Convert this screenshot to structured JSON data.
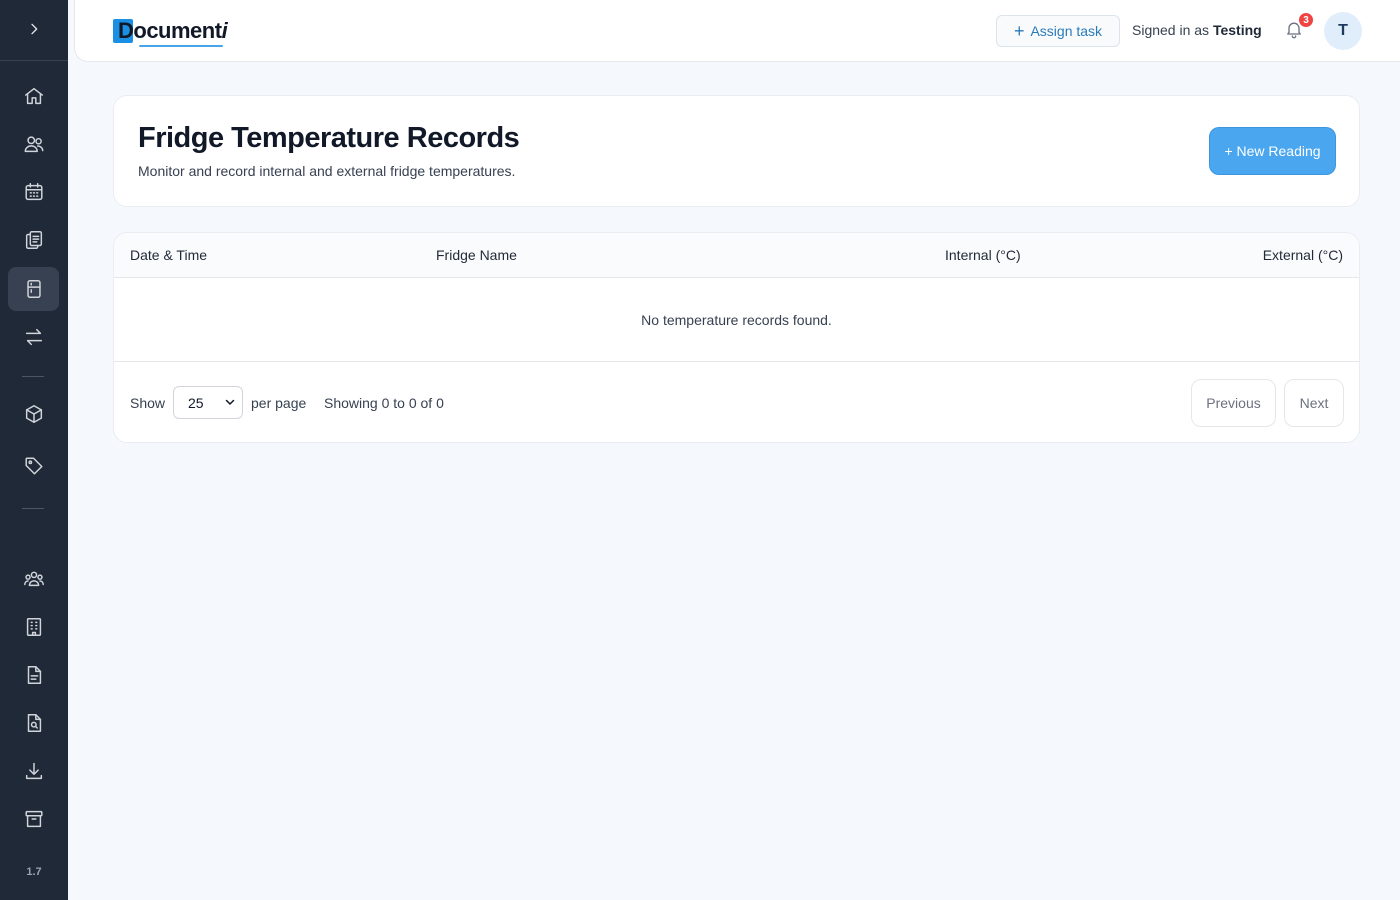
{
  "app": {
    "logo_text": "Documenti",
    "version": "1.7",
    "accent_color": "#1a8fe3"
  },
  "header": {
    "assign_task_label": "Assign task",
    "signed_in_prefix": "Signed in as",
    "user_name": "Testing",
    "notification_count": "3",
    "avatar_initial": "T"
  },
  "sidebar": {
    "toggle_icon": "chevron-right-icon",
    "items": [
      {
        "icon": "home-icon",
        "active": false
      },
      {
        "icon": "users-icon",
        "active": false
      },
      {
        "icon": "calendar-icon",
        "active": false
      },
      {
        "icon": "clipboard-icon",
        "active": false
      },
      {
        "icon": "fridge-icon",
        "active": true
      },
      {
        "icon": "transfer-icon",
        "active": false
      },
      {
        "icon": "box-icon",
        "active": false
      },
      {
        "icon": "tag-icon",
        "active": false
      },
      {
        "icon": "group-icon",
        "active": false
      },
      {
        "icon": "building-icon",
        "active": false
      },
      {
        "icon": "document-icon",
        "active": false
      },
      {
        "icon": "document-search-icon",
        "active": false
      },
      {
        "icon": "download-icon",
        "active": false
      },
      {
        "icon": "archive-icon",
        "active": false
      }
    ]
  },
  "page": {
    "title": "Fridge Temperature Records",
    "subtitle": "Monitor and record internal and external fridge temperatures.",
    "new_reading_label": "+ New Reading",
    "new_reading_color": "#4aa6ee"
  },
  "table": {
    "columns": [
      "Date & Time",
      "Fridge Name",
      "Internal (°C)",
      "External (°C)"
    ],
    "empty_message": "No temperature records found."
  },
  "pagination": {
    "show_label": "Show",
    "per_page_value": "25",
    "per_page_label": "per page",
    "summary": "Showing 0 to 0 of 0",
    "previous_label": "Previous",
    "next_label": "Next"
  }
}
